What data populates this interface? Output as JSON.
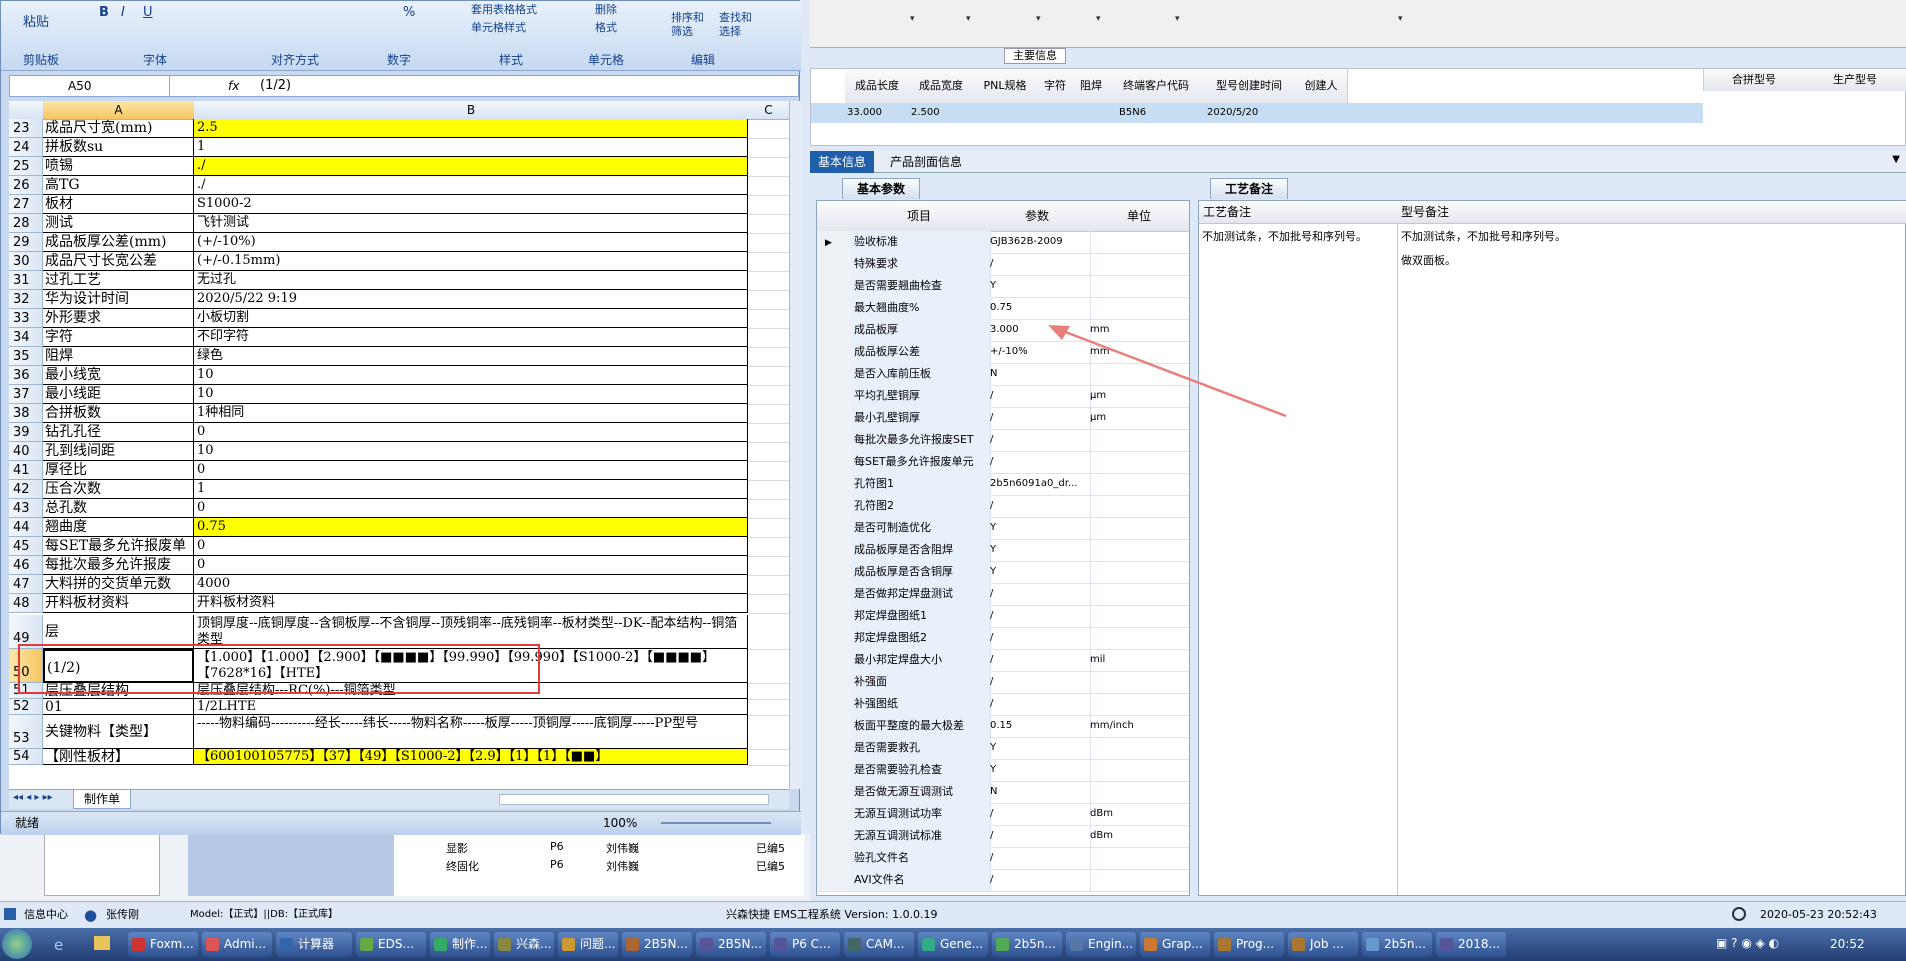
{
  "excel": {
    "ribbon": {
      "paste": "粘贴",
      "clipboard": "剪贴板",
      "font": "字体",
      "align": "对齐方式",
      "number": "数字",
      "styles": "样式",
      "cells": "单元格",
      "edit": "编辑",
      "table_format": "套用表格格式",
      "cell_style": "单元格样式",
      "delete": "删除",
      "format": "格式",
      "sort_filter": "排序和筛选",
      "find_select": "查找和选择",
      "bold": "B",
      "italic": "I",
      "underline": "U",
      "percent": "%",
      "comma": ","
    },
    "name_box": "A50",
    "fx": "fx",
    "formula": "(1/2)",
    "col_a": "A",
    "col_b": "B",
    "col_c": "C",
    "rows": [
      {
        "n": "23",
        "a": "成品尺寸宽(mm)",
        "b": "2.5",
        "y": true
      },
      {
        "n": "24",
        "a": "拼板数su",
        "b": "1",
        "y": false
      },
      {
        "n": "25",
        "a": "喷锡",
        "b": "./",
        "y": true
      },
      {
        "n": "26",
        "a": "高TG",
        "b": "./",
        "y": false
      },
      {
        "n": "27",
        "a": "板材",
        "b": "S1000-2",
        "y": false
      },
      {
        "n": "28",
        "a": "测试",
        "b": "飞针测试",
        "y": false
      },
      {
        "n": "29",
        "a": "成品板厚公差(mm)",
        "b": "(+/-10%)",
        "y": false
      },
      {
        "n": "30",
        "a": "成品尺寸长宽公差",
        "b": "(+/-0.15mm)",
        "y": false
      },
      {
        "n": "31",
        "a": "过孔工艺",
        "b": "无过孔",
        "y": false
      },
      {
        "n": "32",
        "a": "华为设计时间",
        "b": "2020/5/22 9:19",
        "y": false
      },
      {
        "n": "33",
        "a": "外形要求",
        "b": "小板切割",
        "y": false
      },
      {
        "n": "34",
        "a": "字符",
        "b": "不印字符",
        "y": false
      },
      {
        "n": "35",
        "a": "阻焊",
        "b": "绿色",
        "y": false
      },
      {
        "n": "36",
        "a": "最小线宽",
        "b": "10",
        "y": false
      },
      {
        "n": "37",
        "a": "最小线距",
        "b": "10",
        "y": false
      },
      {
        "n": "38",
        "a": "合拼板数",
        "b": "1种相同",
        "y": false
      },
      {
        "n": "39",
        "a": "钻孔孔径",
        "b": "0",
        "y": false
      },
      {
        "n": "40",
        "a": "孔到线间距",
        "b": "10",
        "y": false
      },
      {
        "n": "41",
        "a": "厚径比",
        "b": "0",
        "y": false
      },
      {
        "n": "42",
        "a": "压合次数",
        "b": "1",
        "y": false
      },
      {
        "n": "43",
        "a": "总孔数",
        "b": "0",
        "y": false
      },
      {
        "n": "44",
        "a": "翘曲度",
        "b": "0.75",
        "y": true
      },
      {
        "n": "45",
        "a": "每SET最多允许报废单",
        "b": "0",
        "y": false
      },
      {
        "n": "46",
        "a": "每批次最多允许报废",
        "b": "0",
        "y": false
      },
      {
        "n": "47",
        "a": "大料拼的交货单元数",
        "b": "4000",
        "y": false
      },
      {
        "n": "48",
        "a": "开料板材资料",
        "b": "开料板材资料",
        "y": false
      }
    ],
    "row49": {
      "n": "49",
      "a": "层",
      "b": "顶铜厚度--底铜厚度--含铜板厚--不含铜厚--顶残铜率--底残铜率--板材类型--DK--配本结构--铜箔类型"
    },
    "row50": {
      "n": "50",
      "a": "(1/2)",
      "b": "【1.000】【1.000】【2.900】【■■■■】【99.990】【99.990】【S1000-2】【■■■■】【7628*16】【HTE】"
    },
    "row51": {
      "n": "51",
      "a": "层压叠层结构",
      "b": "层压叠层结构---RC(%)---铜箔类型"
    },
    "row52": {
      "n": "52",
      "a": "01",
      "b": "1/2LHTE"
    },
    "row53": {
      "n": "53",
      "a": "关键物料【类型】",
      "b": "-----物料编码----------经长-----纬长-----物料名称-----板厚-----顶铜厚-----底铜厚-----PP型号"
    },
    "row54": {
      "n": "54",
      "a": "【刚性板材】",
      "b": "【600100105775】【37】【49】【S1000-2】【2.9】【1】【1】【■■】"
    },
    "sheet_tab": "制作单",
    "status": "就绪",
    "zoom": "100%"
  },
  "main_info": {
    "title": "主要信息",
    "headers": [
      "成品长度",
      "成品宽度",
      "PNL规格",
      "字符",
      "阻焊",
      "终端客户代码",
      "型号创建时间",
      "创建人"
    ],
    "values": [
      "33.000",
      "2.500",
      "",
      "",
      "",
      "B5N6",
      "2020/5/20",
      ""
    ],
    "right_headers": [
      "合拼型号",
      "生产型号"
    ]
  },
  "tabs": [
    "基本信息",
    "产品剖面信息"
  ],
  "basic_params": {
    "tab": "基本参数",
    "col_item": "项目",
    "col_param": "参数",
    "col_unit": "单位"
  },
  "params": [
    {
      "i": "验收标准",
      "p": "GJB362B-2009",
      "u": ""
    },
    {
      "i": "特殊要求",
      "p": "/",
      "u": ""
    },
    {
      "i": "是否需要翘曲检查",
      "p": "Y",
      "u": ""
    },
    {
      "i": "最大翘曲度%",
      "p": "0.75",
      "u": ""
    },
    {
      "i": "成品板厚",
      "p": "3.000",
      "u": "mm"
    },
    {
      "i": "成品板厚公差",
      "p": "+/-10%",
      "u": "mm"
    },
    {
      "i": "是否入库前压板",
      "p": "N",
      "u": ""
    },
    {
      "i": "平均孔壁铜厚",
      "p": "/",
      "u": "μm"
    },
    {
      "i": "最小孔壁铜厚",
      "p": "/",
      "u": "μm"
    },
    {
      "i": "每批次最多允许报废SET",
      "p": "/",
      "u": ""
    },
    {
      "i": "每SET最多允许报废单元",
      "p": "/",
      "u": ""
    },
    {
      "i": "孔符图1",
      "p": "2b5n6091a0_dr...",
      "u": ""
    },
    {
      "i": "孔符图2",
      "p": "/",
      "u": ""
    },
    {
      "i": "是否可制造优化",
      "p": "Y",
      "u": ""
    },
    {
      "i": "成品板厚是否含阻焊",
      "p": "Y",
      "u": ""
    },
    {
      "i": "成品板厚是否含铜厚",
      "p": "Y",
      "u": ""
    },
    {
      "i": "是否做邦定焊盘测试",
      "p": "/",
      "u": ""
    },
    {
      "i": "邦定焊盘图纸1",
      "p": "/",
      "u": ""
    },
    {
      "i": "邦定焊盘图纸2",
      "p": "/",
      "u": ""
    },
    {
      "i": "最小邦定焊盘大小",
      "p": "/",
      "u": "mil"
    },
    {
      "i": "补强面",
      "p": "/",
      "u": ""
    },
    {
      "i": "补强图纸",
      "p": "/",
      "u": ""
    },
    {
      "i": "板面平整度的最大极差",
      "p": "0.15",
      "u": "mm/inch"
    },
    {
      "i": "是否需要救孔",
      "p": "Y",
      "u": ""
    },
    {
      "i": "是否需要验孔检查",
      "p": "Y",
      "u": ""
    },
    {
      "i": "是否做无源互调测试",
      "p": "N",
      "u": ""
    },
    {
      "i": "无源互调测试功率",
      "p": "/",
      "u": "dBm"
    },
    {
      "i": "无源互调测试标准",
      "p": "/",
      "u": "dBm"
    },
    {
      "i": "验孔文件名",
      "p": "/",
      "u": ""
    },
    {
      "i": "AVI文件名",
      "p": "/",
      "u": ""
    }
  ],
  "remarks": {
    "tab": "工艺备注",
    "col1": "工艺备注",
    "col2": "型号备注",
    "text1": "不加测试条，不加批号和序列号。",
    "text2a": "不加测试条，不加批号和序列号。",
    "text2b": "做双面板。"
  },
  "bg_tree": [
    {
      "name": "显影",
      "code": "P6",
      "user": "刘伟巍",
      "state": "已编5"
    },
    {
      "name": "终固化",
      "code": "P6",
      "user": "刘伟巍",
      "state": "已编5"
    }
  ],
  "status_bar": {
    "info": "信息中心",
    "user": "张传刚",
    "model": "Model:【正式】||DB:【正式库】",
    "system": "兴森快捷 EMS工程系统 Version: 1.0.0.19",
    "datetime": "2020-05-23 20:52:43"
  },
  "taskbar": {
    "items": [
      "Foxm...",
      "Admi...",
      "计算器",
      "EDS...",
      "制作...",
      "兴森...",
      "问题...",
      "2B5N...",
      "2B5N...",
      "P6 C...",
      "CAM...",
      "Gene...",
      "2b5n...",
      "Engin...",
      "Grap...",
      "Prog...",
      "Job ...",
      "2b5n...",
      "2018..."
    ],
    "clock": "20:52"
  },
  "colors": {
    "accent": "#1f5ea8",
    "highlight": "#ffff00",
    "annotation": "#e53a3a"
  }
}
